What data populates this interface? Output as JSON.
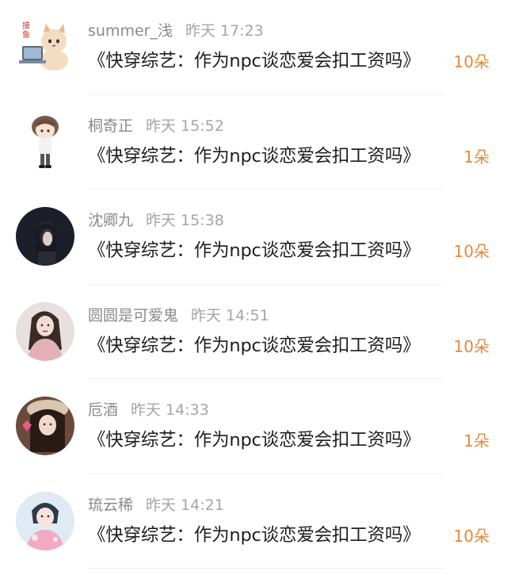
{
  "comments": [
    {
      "username": "summer_浅",
      "time": "昨天 17:23",
      "text": "《快穿综艺：作为npc谈恋爱会扣工资吗》",
      "count": "10朵",
      "avatar": "cartoon-cat-avatar"
    },
    {
      "username": "桐奇正",
      "time": "昨天 15:52",
      "text": "《快穿综艺：作为npc谈恋爱会扣工资吗》",
      "count": "1朵",
      "avatar": "chibi-boy-avatar"
    },
    {
      "username": "沈卿九",
      "time": "昨天 15:38",
      "text": "《快穿综艺：作为npc谈恋爱会扣工资吗》",
      "count": "10朵",
      "avatar": "dark-portrait-avatar"
    },
    {
      "username": "圆圆是可爱鬼",
      "time": "昨天 14:51",
      "text": "《快穿综艺：作为npc谈恋爱会扣工资吗》",
      "count": "10朵",
      "avatar": "girl-portrait-avatar"
    },
    {
      "username": "卮酒",
      "time": "昨天 14:33",
      "text": "《快穿综艺：作为npc谈恋爱会扣工资吗》",
      "count": "1朵",
      "avatar": "hat-girl-avatar"
    },
    {
      "username": "琉云稀",
      "time": "昨天 14:21",
      "text": "《快穿综艺：作为npc谈恋爱会扣工资吗》",
      "count": "10朵",
      "avatar": "pink-outfit-avatar"
    }
  ],
  "colors": {
    "count": "#e48a3a",
    "username": "#8a8a8a",
    "text": "#1e1e1e"
  }
}
